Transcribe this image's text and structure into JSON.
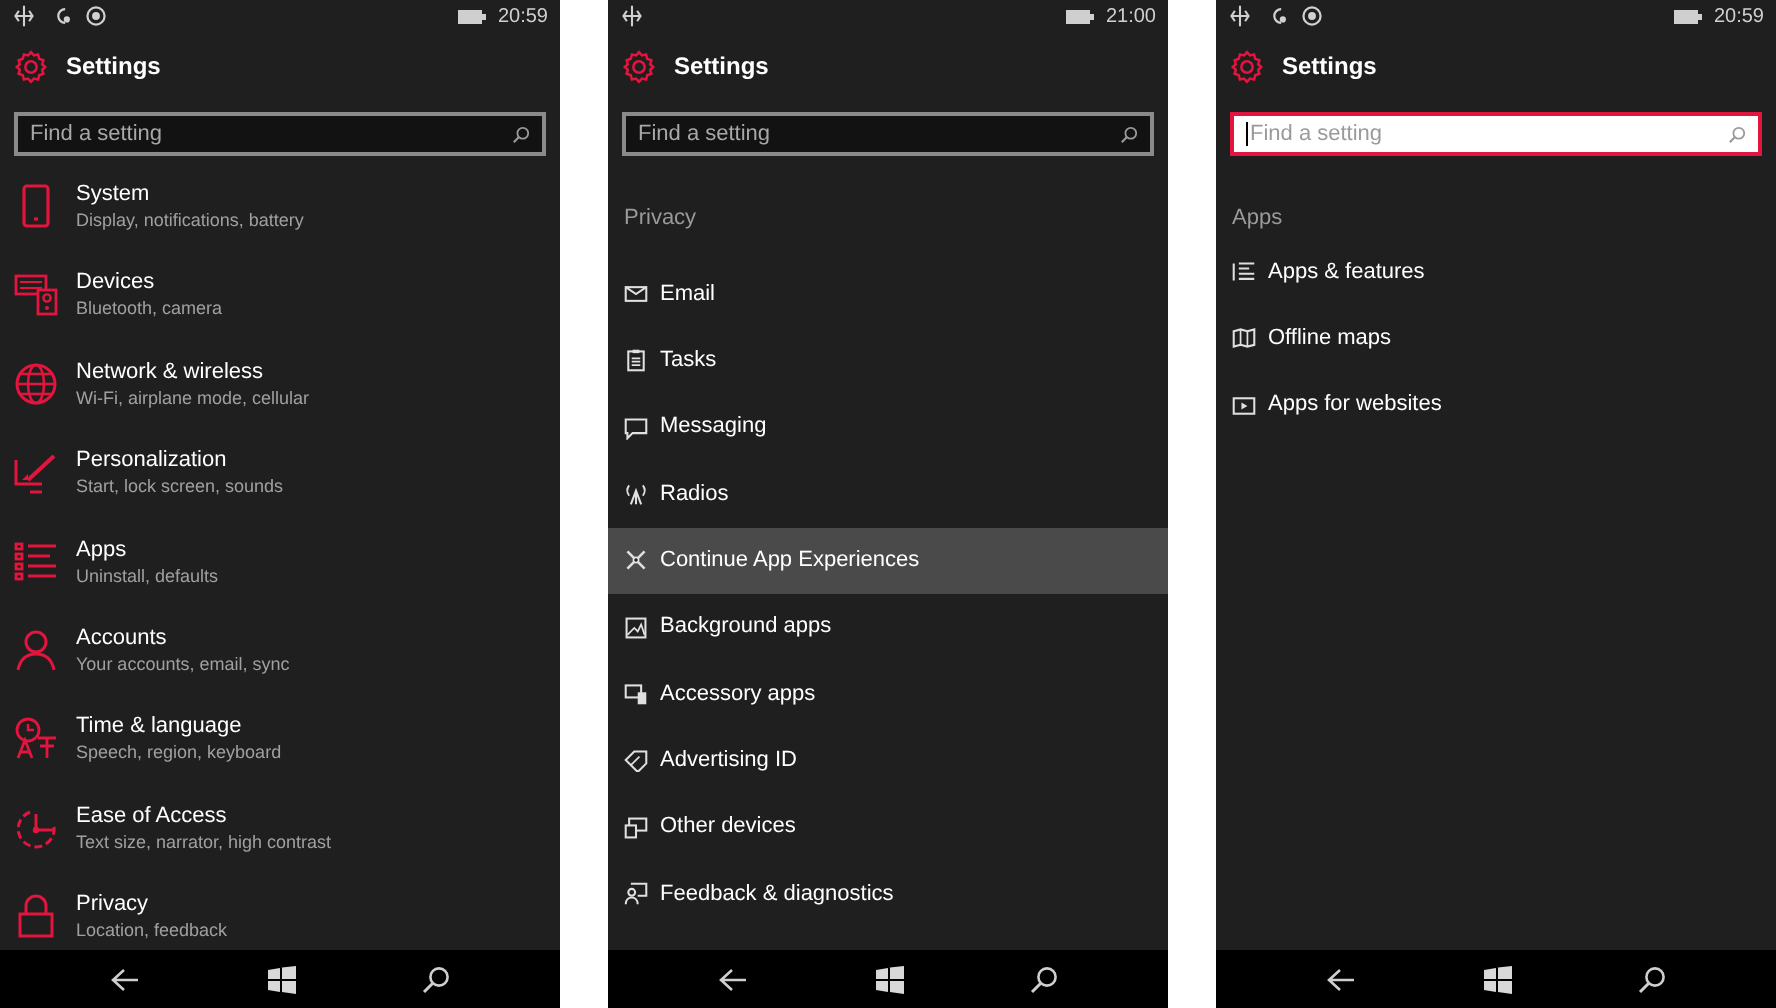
{
  "phones": [
    {
      "status_bar": {
        "indicators": [
          {
            "kind": "arrows"
          },
          {
            "kind": "person"
          },
          {
            "kind": "ring"
          }
        ],
        "time": "20:59"
      },
      "title": "Settings",
      "search": {
        "placeholder": "Find a setting",
        "focused": false
      },
      "items": [
        {
          "label": "System",
          "subtitle": "Display, notifications, battery",
          "selected": false
        },
        {
          "label": "Devices",
          "subtitle": "Bluetooth, camera",
          "selected": false
        },
        {
          "label": "Network & wireless",
          "subtitle": "Wi-Fi, airplane mode, cellular",
          "selected": false
        },
        {
          "label": "Personalization",
          "subtitle": "Start, lock screen, sounds",
          "selected": false
        },
        {
          "label": "Apps",
          "subtitle": "Uninstall, defaults",
          "selected": false
        },
        {
          "label": "Accounts",
          "subtitle": "Your accounts, email, sync",
          "selected": false
        },
        {
          "label": "Time & language",
          "subtitle": "Speech, region, keyboard",
          "selected": false
        },
        {
          "label": "Ease of Access",
          "subtitle": "Text size, narrator, high contrast",
          "selected": false
        },
        {
          "label": "Privacy",
          "subtitle": "Location, feedback",
          "selected": false
        }
      ]
    },
    {
      "status_bar": {
        "indicators": [
          {
            "kind": "arrows"
          }
        ],
        "time": "21:00"
      },
      "title": "Settings",
      "search": {
        "placeholder": "Find a setting",
        "focused": false
      },
      "section": "Privacy",
      "items": [
        {
          "label": "Email",
          "selected": false
        },
        {
          "label": "Tasks",
          "selected": false
        },
        {
          "label": "Messaging",
          "selected": false
        },
        {
          "label": "Radios",
          "selected": false
        },
        {
          "label": "Continue App Experiences",
          "selected": true
        },
        {
          "label": "Background apps",
          "selected": false
        },
        {
          "label": "Accessory apps",
          "selected": false
        },
        {
          "label": "Advertising ID",
          "selected": false
        },
        {
          "label": "Other devices",
          "selected": false
        },
        {
          "label": "Feedback & diagnostics",
          "selected": false
        }
      ]
    },
    {
      "status_bar": {
        "indicators": [
          {
            "kind": "arrows"
          },
          {
            "kind": "person"
          },
          {
            "kind": "ring"
          }
        ],
        "time": "20:59"
      },
      "title": "Settings",
      "search": {
        "placeholder": "Find a setting",
        "focused": true
      },
      "section": "Apps",
      "items": [
        {
          "label": "Apps & features",
          "selected": false
        },
        {
          "label": "Offline maps",
          "selected": false
        },
        {
          "label": "Apps for websites",
          "selected": false
        }
      ]
    }
  ]
}
